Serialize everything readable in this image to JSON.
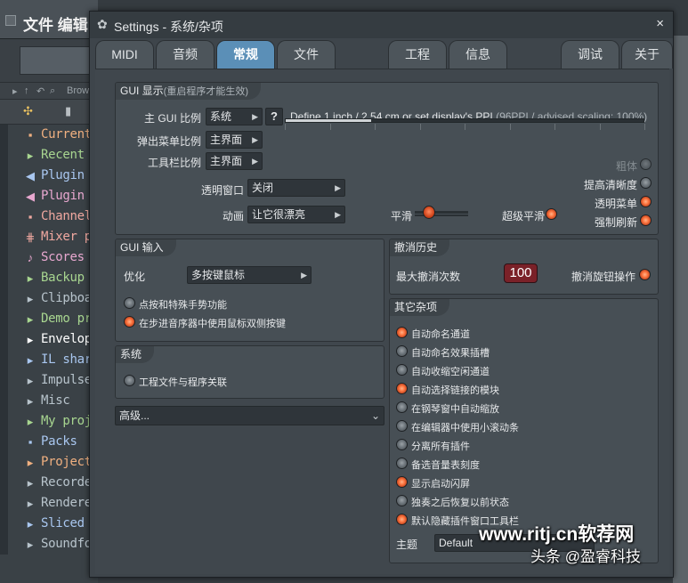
{
  "background_app": {
    "title": "文件 编辑",
    "browser_label": "Brow",
    "browser_items": [
      {
        "icon": "▪",
        "label": "Current p",
        "color": "#f0b080"
      },
      {
        "icon": "▸",
        "label": "Recent fi",
        "color": "#a8d690"
      },
      {
        "icon": "◀",
        "label": "Plugin da",
        "color": "#a9c7f0"
      },
      {
        "icon": "◀",
        "label": "Plugin pr",
        "color": "#e8a8d0"
      },
      {
        "icon": "▪",
        "label": "Channel",
        "color": "#f0a8a0"
      },
      {
        "icon": "⋕",
        "label": "Mixer pre",
        "color": "#f0a8a0"
      },
      {
        "icon": "♪",
        "label": "Scores",
        "color": "#e8a8d0"
      },
      {
        "icon": "▸",
        "label": "Backup",
        "color": "#a8d690"
      },
      {
        "icon": "▸",
        "label": "Clipboard",
        "color": "#b8c4cc"
      },
      {
        "icon": "▸",
        "label": "Demo pro",
        "color": "#a8d690"
      },
      {
        "icon": "▸",
        "label": "Envelope",
        "color": "#ffffff"
      },
      {
        "icon": "▸",
        "label": "IL shared",
        "color": "#a9c7f0"
      },
      {
        "icon": "▸",
        "label": "Impulses",
        "color": "#b8c4cc"
      },
      {
        "icon": "▸",
        "label": "Misc",
        "color": "#b8c4cc"
      },
      {
        "icon": "▸",
        "label": "My proje",
        "color": "#a8d690"
      },
      {
        "icon": "▪",
        "label": "Packs",
        "color": "#a9c7f0"
      },
      {
        "icon": "▸",
        "label": "Project b",
        "color": "#f0b080"
      },
      {
        "icon": "▸",
        "label": "Recorded",
        "color": "#b8c4cc"
      },
      {
        "icon": "▸",
        "label": "Rendered",
        "color": "#b8c4cc"
      },
      {
        "icon": "▸",
        "label": "Sliced au",
        "color": "#a9c7f0"
      },
      {
        "icon": "▸",
        "label": "Soundfon",
        "color": "#b8c4cc"
      }
    ]
  },
  "window": {
    "title": "Settings - 系统/杂项",
    "close_glyph": "×",
    "gear_glyph": "✿"
  },
  "tabs": [
    {
      "label": "MIDI",
      "active": false
    },
    {
      "label": "音频",
      "active": false
    },
    {
      "label": "常规",
      "active": true
    },
    {
      "label": "文件",
      "active": false
    },
    {
      "label": "工程",
      "active": false
    },
    {
      "label": "信息",
      "active": false
    },
    {
      "label": "调试",
      "active": false
    },
    {
      "label": "关于",
      "active": false
    }
  ],
  "gui_display": {
    "title": "GUI 显示",
    "title_note": "(重启程序才能生效)",
    "main_scale_label": "主 GUI 比例",
    "main_scale_value": "系统",
    "help_button": "?",
    "ppi_text": "Define 1 inch / 2.54 cm or set display's PPI",
    "ppi_note": "(96PPI / advised scaling: 100%)",
    "ppi_fraction": 0.24,
    "popup_scale_label": "弹出菜单比例",
    "popup_scale_value": "主界面",
    "toolbar_scale_label": "工具栏比例",
    "toolbar_scale_value": "主界面",
    "transparent_label": "透明窗口",
    "transparent_value": "关闭",
    "animation_label": "动画",
    "animation_value": "让它很漂亮",
    "smooth_label": "平滑",
    "smooth_level": 0.2,
    "super_smooth_label": "超级平滑",
    "super_smooth_on": true,
    "bold_label": "粗体",
    "bold_on": false,
    "sharpen_label": "提高清晰度",
    "sharpen_on": false,
    "transparent_menu_label": "透明菜单",
    "transparent_menu_on": true,
    "force_refresh_label": "强制刷新",
    "force_refresh_on": true
  },
  "gui_input": {
    "title": "GUI 输入",
    "optimize_label": "优化",
    "optimize_value": "多按键鼠标",
    "options": [
      {
        "label": "点按和特殊手势功能",
        "on": false
      },
      {
        "label": "在步进音序器中使用鼠标双侧按键",
        "on": true
      }
    ]
  },
  "system": {
    "title": "系统",
    "options": [
      {
        "label": "工程文件与程序关联",
        "on": false
      }
    ]
  },
  "advanced": {
    "label": "高级..."
  },
  "undo_history": {
    "title": "撤消历史",
    "max_label": "最大撤消次数",
    "max_value": "100",
    "knob_label": "撤消旋钮操作",
    "knob_on": true
  },
  "misc": {
    "title": "其它杂项",
    "options": [
      {
        "label": "自动命名通道",
        "on": true
      },
      {
        "label": "自动命名效果插槽",
        "on": false
      },
      {
        "label": "自动收缩空闲通道",
        "on": false
      },
      {
        "label": "自动选择链接的模块",
        "on": true
      },
      {
        "label": "在钢琴窗中自动缩放",
        "on": false
      },
      {
        "label": "在编辑器中使用小滚动条",
        "on": false
      },
      {
        "label": "分离所有插件",
        "on": false
      },
      {
        "label": "备选音量表刻度",
        "on": false
      },
      {
        "label": "显示启动闪屏",
        "on": true
      },
      {
        "label": "独奏之后恢复以前状态",
        "on": false
      },
      {
        "label": "默认隐藏插件窗口工具栏",
        "on": true
      }
    ],
    "theme_label": "主题",
    "theme_value": "Default"
  },
  "watermark": {
    "line1": "www.ritj.cn软荐网",
    "line2": "头条 @盈睿科技"
  },
  "colors": {
    "accent_tab": "#5b8fb7",
    "led_on": "#ff7a45",
    "undo_box": "#7a2128"
  }
}
